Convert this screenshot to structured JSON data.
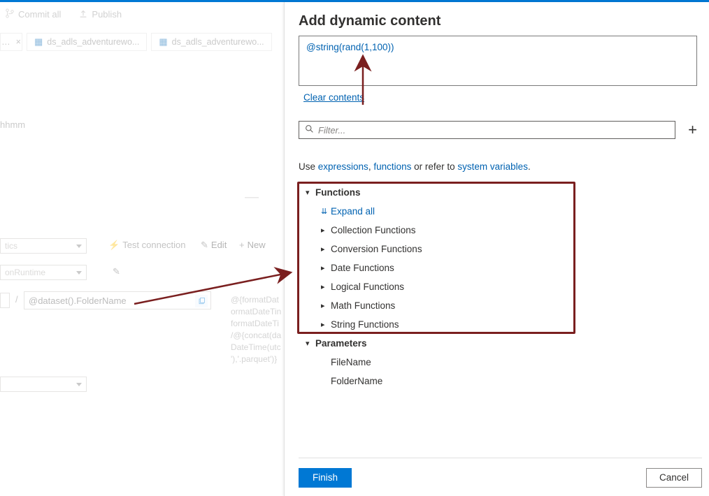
{
  "toolbar": {
    "commit_all": "Commit all",
    "publish": "Publish"
  },
  "tabs": {
    "dots": "…",
    "t1": "ds_adls_adventurewo...",
    "t2": "ds_adls_adventurewo..."
  },
  "left": {
    "format_hint": "hhmm",
    "tics_label": "tics",
    "test_connection": "Test connection",
    "edit": "Edit",
    "new": "New",
    "runtime_label": "onRuntime",
    "slash": "/",
    "folder_input": "@dataset().FolderName",
    "longcode": "@{formatDat\normatDateTin\nformatDateTi\n/@{concat(da\nDateTime(utc\n'),'.parquet')}"
  },
  "panel": {
    "title": "Add dynamic content",
    "expression": "@string(rand(1,100))",
    "clear": "Clear contents",
    "filter_placeholder": "Filter...",
    "help_prefix": "Use ",
    "help_expr": "expressions",
    "help_mid": ", ",
    "help_func": "functions",
    "help_mid2": " or refer to ",
    "help_sys": "system variables",
    "help_suffix": "."
  },
  "tree": {
    "functions": "Functions",
    "expand_all": "Expand all",
    "collection": "Collection Functions",
    "conversion": "Conversion Functions",
    "date": "Date Functions",
    "logical": "Logical Functions",
    "math": "Math Functions",
    "string": "String Functions",
    "parameters": "Parameters",
    "param_file": "FileName",
    "param_folder": "FolderName"
  },
  "footer": {
    "finish": "Finish",
    "cancel": "Cancel"
  }
}
